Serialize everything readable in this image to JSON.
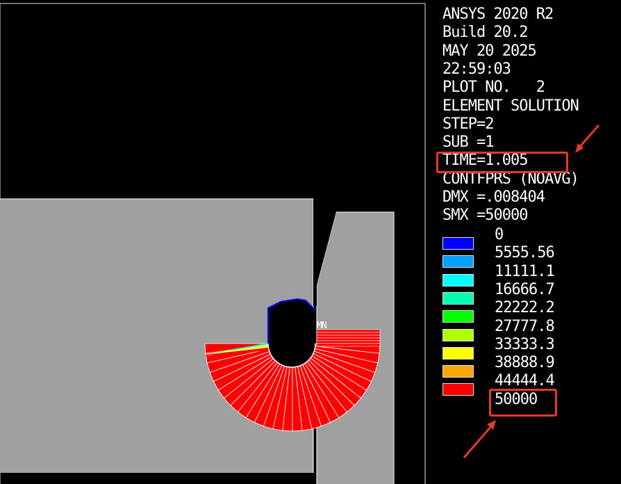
{
  "info": {
    "lines": [
      "ANSYS 2020 R2",
      "Build 20.2",
      "MAY 20 2025",
      "22:59:03",
      "PLOT NO.   2",
      "ELEMENT SOLUTION",
      "STEP=2",
      "SUB =1",
      "TIME=1.005",
      "CONTFPRS (NOAVG)",
      "DMX =.008404",
      "SMX =50000"
    ]
  },
  "legend": {
    "values": [
      "0",
      "5555.56",
      "11111.1",
      "16666.7",
      "22222.2",
      "27777.8",
      "33333.3",
      "38888.9",
      "44444.4",
      "50000"
    ],
    "colors": [
      "#0000ff",
      "#00a0ff",
      "#00ffff",
      "#00ffb0",
      "#00ff00",
      "#b0ff00",
      "#ffff00",
      "#ffa500",
      "#ff0000"
    ]
  },
  "plot": {
    "minmax_label": "MN",
    "body_color": "#a0a0a0",
    "contour_color": "#ff0000",
    "hole_edge_color": "#0000ff"
  },
  "annotations": {
    "highlight_color": "#e53a2a"
  }
}
